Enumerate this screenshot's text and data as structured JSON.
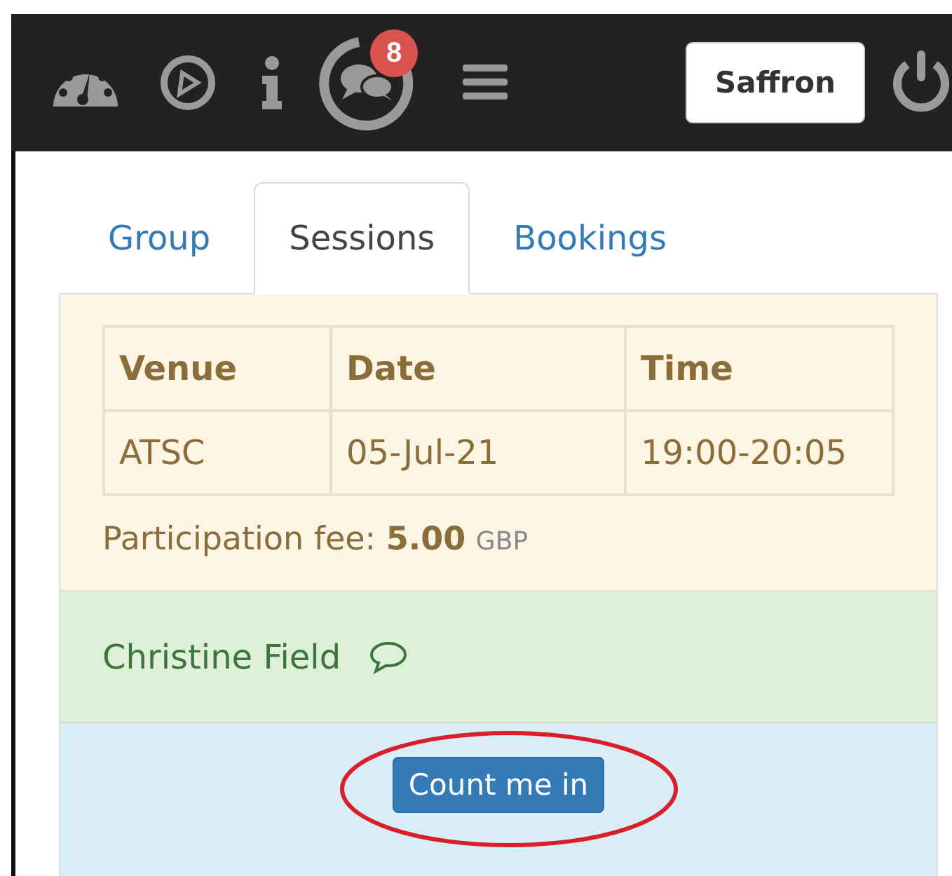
{
  "navbar": {
    "badge": "8",
    "user_button": "Saffron"
  },
  "tabs": [
    {
      "label": "Group",
      "selected": false
    },
    {
      "label": "Sessions",
      "selected": true
    },
    {
      "label": "Bookings",
      "selected": false
    }
  ],
  "session": {
    "table": {
      "columns": [
        "Venue",
        "Date",
        "Time"
      ],
      "rows": [
        [
          "ATSC",
          "05-Jul-21",
          "19:00-20:05"
        ]
      ]
    },
    "fee_label": "Participation fee:",
    "fee_amount": "5.00",
    "fee_currency": "GBP",
    "leader": "Christine Field",
    "action_button": "Count me in"
  }
}
